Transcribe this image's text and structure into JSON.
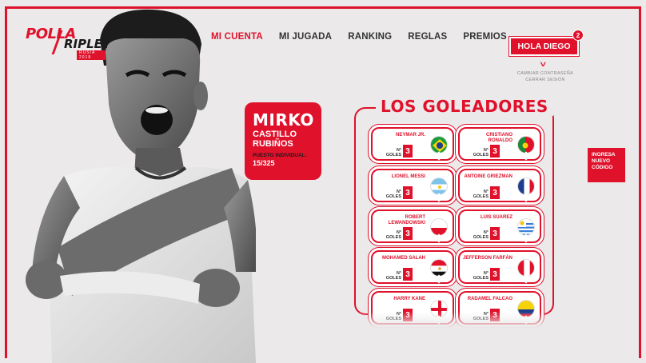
{
  "logo": {
    "polla": "POLLA",
    "ripley": "RIPLEY",
    "sub": "RUSIA 2018"
  },
  "nav": [
    {
      "label": "MI CUENTA"
    },
    {
      "label": "MI JUGADA"
    },
    {
      "label": "RANKING"
    },
    {
      "label": "REGLAS"
    },
    {
      "label": "PREMIOS"
    }
  ],
  "user": {
    "greeting": "HOLA DIEGO",
    "badge": "2",
    "change_password": "CAMBIAR CONTRASEÑA",
    "logout": "CERRAR SESIÓN"
  },
  "profile": {
    "first_name": "MIRKO",
    "last_name_1": "CASTILLO",
    "last_name_2": "RUBIÑOS",
    "rank_label": "PUESTO INDIVIDUAL:",
    "rank_value": "15/325"
  },
  "scorers": {
    "title": "LOS GOLEADORES",
    "goals_label_1": "N°",
    "goals_label_2": "GOLES",
    "players": [
      {
        "name": "NEYMAR JR.",
        "goals": "3",
        "flag": "brazil"
      },
      {
        "name": "CRISTIANO RONALDO",
        "goals": "3",
        "flag": "portugal"
      },
      {
        "name": "LIONEL MESSI",
        "goals": "3",
        "flag": "argentina"
      },
      {
        "name": "ANTOINE GRIEZMAN",
        "goals": "3",
        "flag": "france"
      },
      {
        "name": "ROBERT LEWANDOWSKI",
        "goals": "3",
        "flag": "poland"
      },
      {
        "name": "LUIS SUAREZ",
        "goals": "3",
        "flag": "uruguay"
      },
      {
        "name": "MOHAMED SALAH",
        "goals": "3",
        "flag": "egypt"
      },
      {
        "name": "JEFFERSON FARFÁN",
        "goals": "3",
        "flag": "peru"
      },
      {
        "name": "HARRY KANE",
        "goals": "3",
        "flag": "england"
      },
      {
        "name": "RADAMEL FALCAO",
        "goals": "3",
        "flag": "colombia"
      }
    ]
  },
  "new_code": {
    "line1": "INGRESA",
    "line2": "NUEVO",
    "line3": "CÓDIGO"
  },
  "colors": {
    "accent": "#e0112b",
    "background": "#ebe9ea"
  }
}
